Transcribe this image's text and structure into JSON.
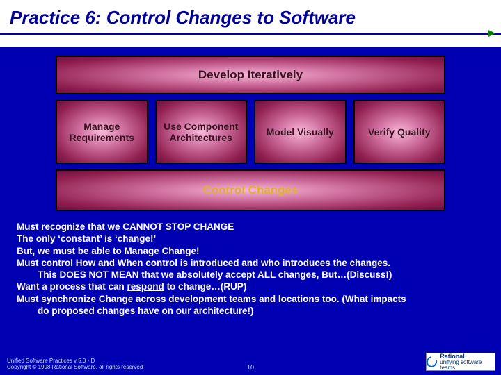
{
  "title": "Practice 6: Control Changes to Software",
  "diagram": {
    "top": "Develop Iteratively",
    "cells": [
      "Manage Requirements",
      "Use Component Architectures",
      "Model Visually",
      "Verify Quality"
    ],
    "bottom": "Control Changes"
  },
  "bullets": {
    "l1": "Must recognize that we CANNOT STOP CHANGE",
    "l2": "The only ‘constant’ is ‘change!’",
    "l3": "But, we must be able to Manage Change!",
    "l4": "Must control How and When control is introduced and who introduces the changes.",
    "l5": "This DOES NOT MEAN that we absolutely accept ALL changes, But…(Discuss!)",
    "l6a": "Want a process that can ",
    "l6b": "respond",
    "l6c": " to change…(RUP)",
    "l7": "Must synchronize Change across development teams and locations too.  (What impacts",
    "l8": "do proposed changes have on our architecture!)"
  },
  "footer": {
    "line1": "Unified Software Practices v 5.0 - D",
    "line2": "Copyright © 1998 Rational Software, all rights reserved"
  },
  "pagenum": "10",
  "logo": {
    "brand": "Rational",
    "tag": "unifying software teams"
  }
}
